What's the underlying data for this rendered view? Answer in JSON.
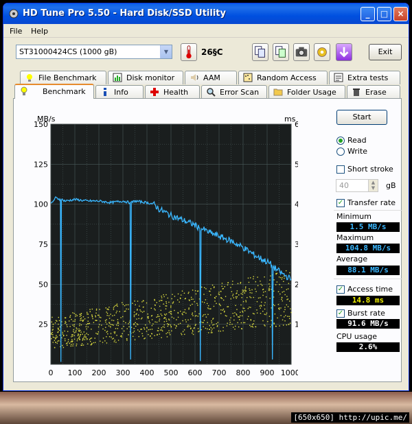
{
  "window": {
    "title": "HD Tune Pro 5.50 - Hard Disk/SSD Utility"
  },
  "menu": {
    "file": "File",
    "help": "Help"
  },
  "toolbar": {
    "drive": "ST31000424CS (1000 gB)",
    "temperature": "26§C",
    "exit_label": "Exit"
  },
  "tabs_top": [
    {
      "label": "File Benchmark"
    },
    {
      "label": "Disk monitor"
    },
    {
      "label": "AAM"
    },
    {
      "label": "Random Access"
    },
    {
      "label": "Extra tests"
    }
  ],
  "tabs_bottom": [
    {
      "label": "Benchmark",
      "active": true
    },
    {
      "label": "Info"
    },
    {
      "label": "Health"
    },
    {
      "label": "Error Scan"
    },
    {
      "label": "Folder Usage"
    },
    {
      "label": "Erase"
    }
  ],
  "side": {
    "start_label": "Start",
    "read_label": "Read",
    "write_label": "Write",
    "short_stroke_label": "Short stroke",
    "short_stroke_value": "40",
    "short_stroke_unit": "gB",
    "transfer_rate_label": "Transfer rate",
    "minimum_label": "Minimum",
    "minimum_value": "1.5 MB/s",
    "maximum_label": "Maximum",
    "maximum_value": "104.8 MB/s",
    "average_label": "Average",
    "average_value": "88.1 MB/s",
    "access_time_label": "Access time",
    "access_time_value": "14.8 ms",
    "burst_rate_label": "Burst rate",
    "burst_rate_value": "91.6 MB/s",
    "cpu_label": "CPU usage",
    "cpu_value": "2.6%"
  },
  "watermark": "[650x650] http://upic.me/",
  "colors": {
    "title_bar": "#0a5fe8",
    "chart_bg": "#1a1e1e",
    "grid": "#4a5a5a",
    "transfer_line": "#3ab7ff",
    "access_dots": "#e0e040"
  },
  "chart_data": {
    "type": "line",
    "xlabel": "gB",
    "ylabel": "MB/s",
    "y2label": "ms",
    "xlim": [
      0,
      1000
    ],
    "ylim": [
      0,
      150
    ],
    "y2lim": [
      0,
      60
    ],
    "x_ticks": [
      "0",
      "100",
      "200",
      "300",
      "400",
      "500",
      "600",
      "700",
      "800",
      "900",
      "1000gB"
    ],
    "y_ticks": [
      "25",
      "50",
      "75",
      "100",
      "125",
      "150"
    ],
    "y2_ticks": [
      "10",
      "20",
      "30",
      "40",
      "50",
      "60"
    ],
    "series": [
      {
        "name": "Transfer rate",
        "x": [
          0,
          20,
          40,
          42,
          44,
          60,
          100,
          150,
          200,
          250,
          300,
          330,
          332,
          335,
          350,
          400,
          430,
          450,
          500,
          550,
          600,
          620,
          622,
          625,
          650,
          700,
          750,
          800,
          850,
          900,
          920,
          922,
          925,
          950,
          1000
        ],
        "y": [
          100,
          104,
          103,
          1.5,
          103,
          102,
          103,
          102,
          102,
          101,
          102,
          101,
          3,
          101,
          102,
          101,
          100,
          97,
          93,
          90,
          87,
          85,
          2,
          85,
          83,
          80,
          77,
          73,
          68,
          64,
          62,
          3,
          61,
          58,
          53
        ]
      }
    ],
    "access_time": {
      "ms_min": 5,
      "ms_max": 25,
      "average_ms": 14.8,
      "spread_trend": "rising with position"
    }
  }
}
